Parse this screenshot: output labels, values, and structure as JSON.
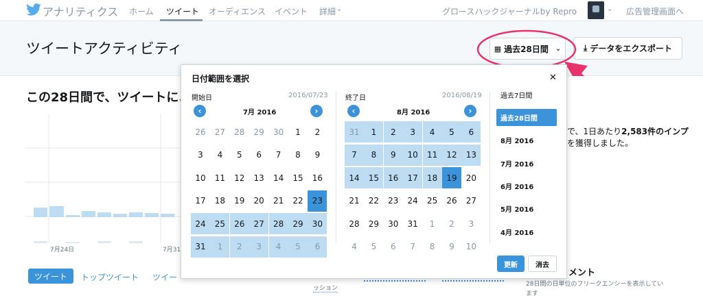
{
  "topnav": {
    "brand": "アナリティクス",
    "items": [
      "ホーム",
      "ツイート",
      "オーディエンス",
      "イベント",
      "詳細"
    ],
    "account": "グロースハックジャーナルby Repro",
    "ads_link": "広告管理画面へ"
  },
  "header": {
    "title": "ツイートアクティビティ",
    "range_button": "過去28日間",
    "export_button": "データをエクスポート"
  },
  "summary": {
    "heading_prefix": "この",
    "heading_bold": "28日間",
    "heading_suffix": "で、ツイートによ",
    "right_line1_a": "で、1日あたり",
    "right_line1_b": "2,583件のインプ",
    "right_line2": "を獲得しました。"
  },
  "chart": {
    "x_labels": [
      "7月24日",
      "7月31"
    ]
  },
  "bottom": {
    "tabs": [
      "ツイート",
      "トップツイート",
      "ツイー"
    ],
    "engagement_fragment": "ッション",
    "panel_title": "メント",
    "panel_desc_1": "28日間の日単位のフリークエンシーを表示してい",
    "panel_desc_2": "ます"
  },
  "picker": {
    "title": "日付範囲を選択",
    "close": "✕",
    "start_label": "開始日",
    "start_value": "2016/07/23",
    "end_label": "終了日",
    "end_value": "2016/08/19",
    "left_month": "7月 2016",
    "right_month": "8月 2016",
    "left_days": [
      "26",
      "27",
      "28",
      "29",
      "30",
      "1",
      "2",
      "3",
      "4",
      "5",
      "6",
      "7",
      "8",
      "9",
      "10",
      "11",
      "12",
      "13",
      "14",
      "15",
      "16",
      "17",
      "18",
      "19",
      "20",
      "21",
      "22",
      "23",
      "24",
      "25",
      "26",
      "27",
      "28",
      "29",
      "30",
      "31",
      "1",
      "2",
      "3",
      "4",
      "5",
      "6"
    ],
    "right_days": [
      "31",
      "1",
      "2",
      "3",
      "4",
      "5",
      "6",
      "7",
      "8",
      "9",
      "10",
      "11",
      "12",
      "13",
      "14",
      "15",
      "16",
      "17",
      "18",
      "19",
      "20",
      "21",
      "22",
      "23",
      "24",
      "25",
      "26",
      "27",
      "28",
      "29",
      "30",
      "31",
      "1",
      "2",
      "3",
      "4",
      "5",
      "6",
      "7",
      "8",
      "9",
      "10"
    ],
    "presets": [
      "過去7日間",
      "過去28日間",
      "8月 2016",
      "7月 2016",
      "6月 2016",
      "5月 2016",
      "4月 2016"
    ],
    "update": "更新",
    "clear": "消去"
  },
  "colors": {
    "accent": "#3b94d9",
    "selected": "#bddcf1",
    "annotation": "#e8336d"
  }
}
